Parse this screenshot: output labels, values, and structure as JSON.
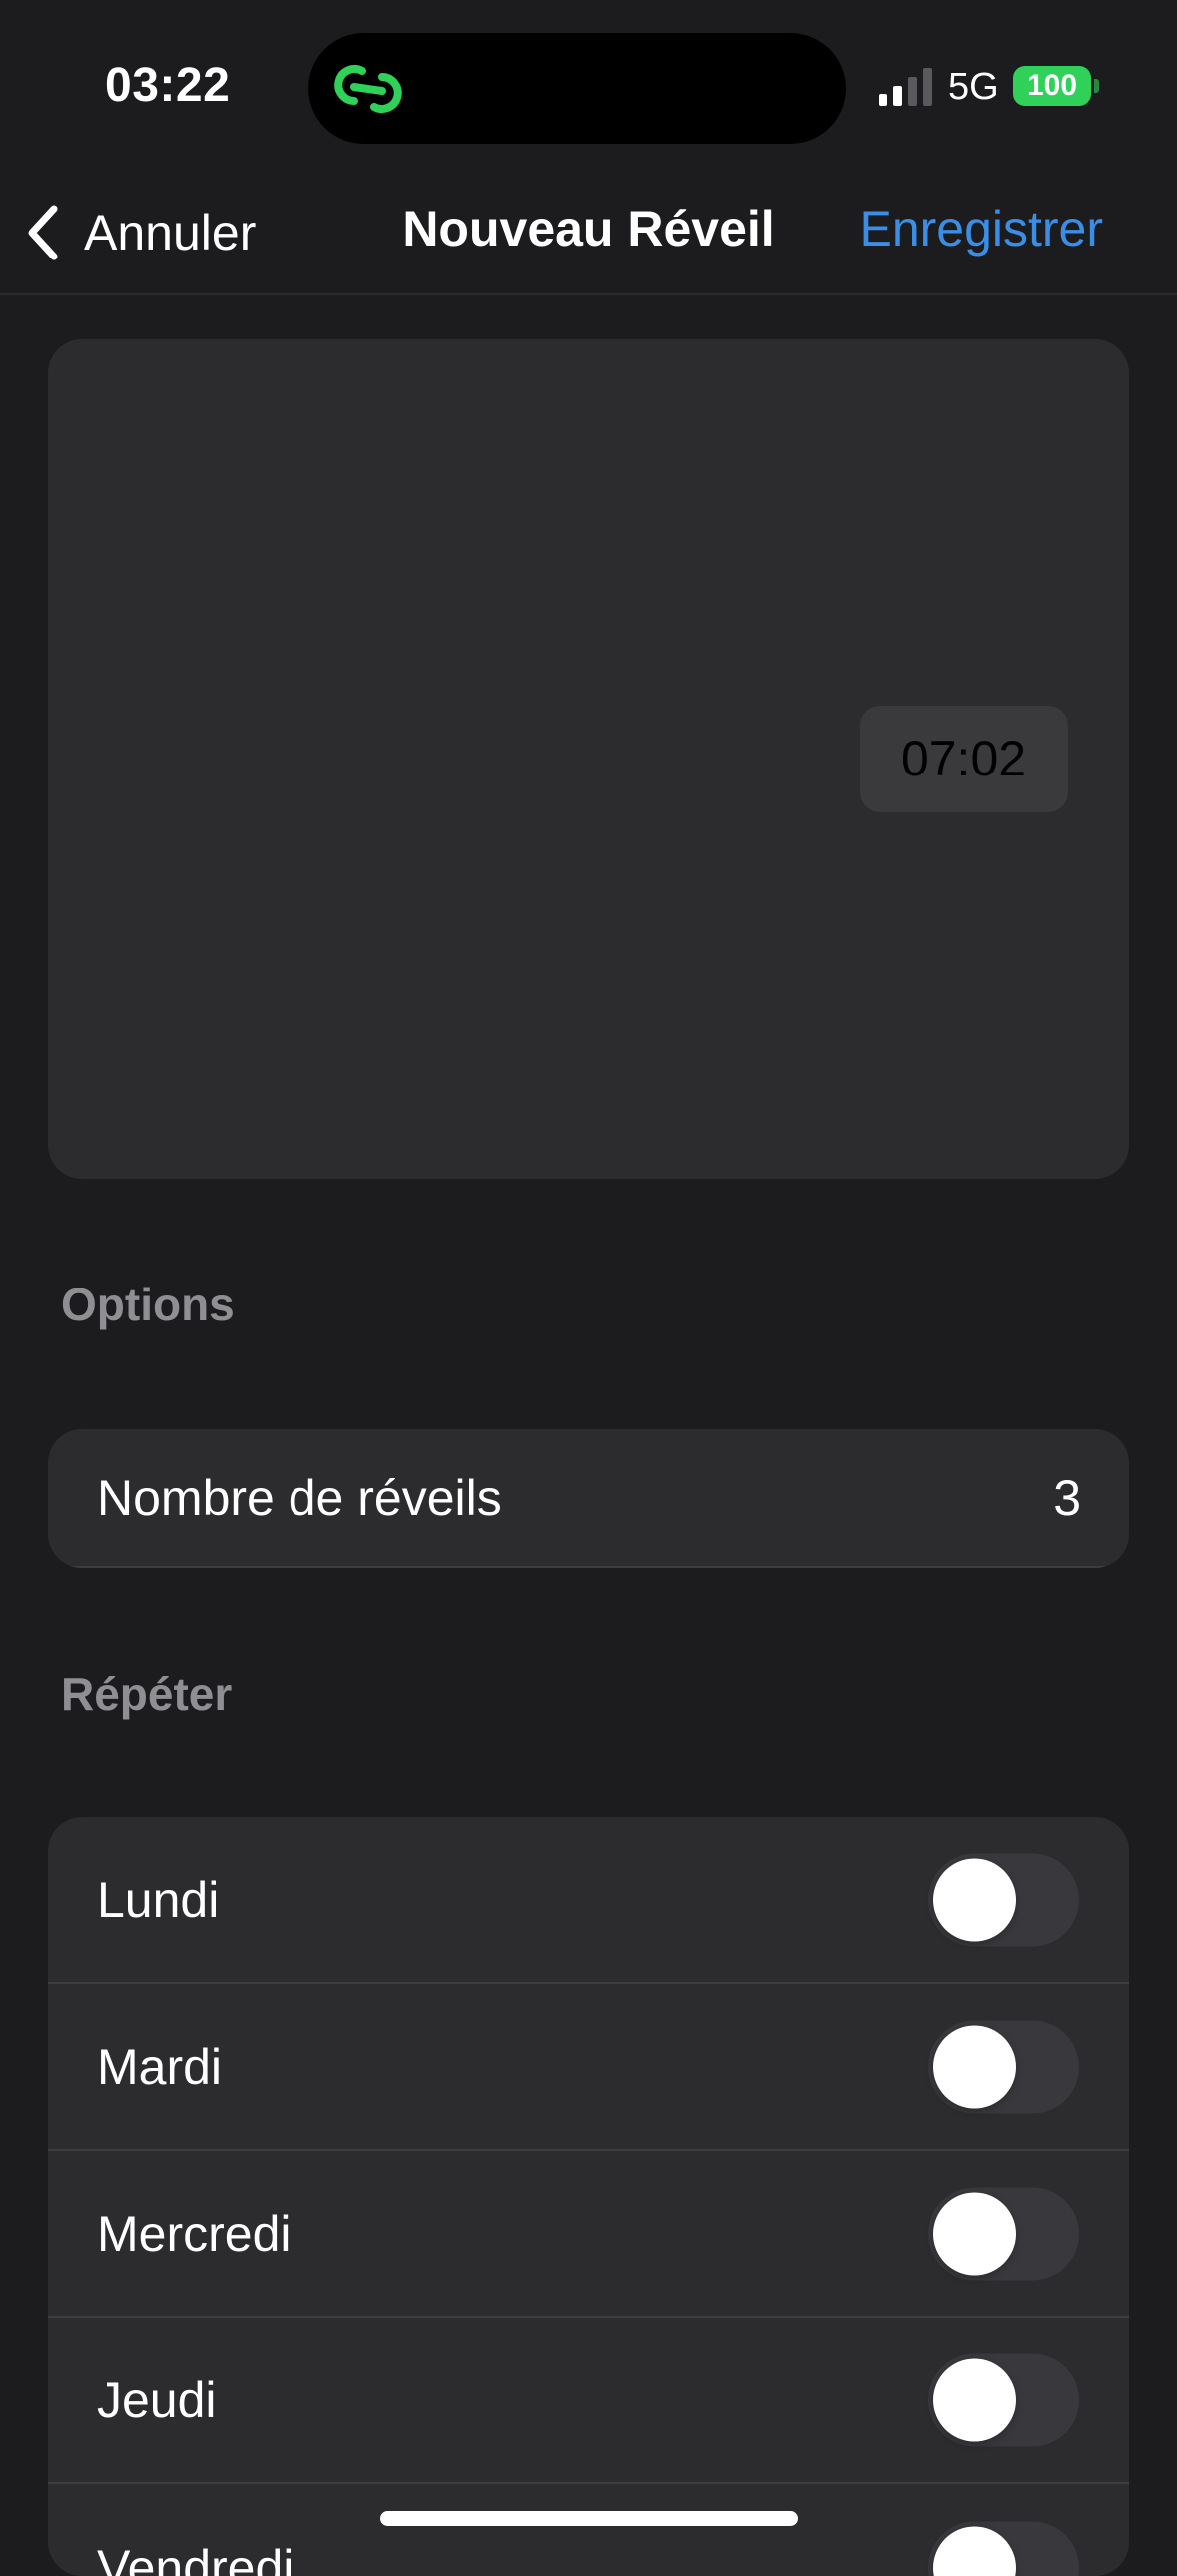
{
  "status_bar": {
    "time": "03:22",
    "network": "5G",
    "battery": "100",
    "island_icon": "link-chain-icon",
    "accent_green": "#30d158"
  },
  "nav": {
    "back_label": "Annuler",
    "title": "Nouveau Réveil",
    "save_label": "Enregistrer",
    "accent_blue": "#3a8ee6"
  },
  "picker": {
    "time": "07:02"
  },
  "options": {
    "header": "Options",
    "rows": [
      {
        "label": "Nombre de réveils",
        "value": "3"
      }
    ]
  },
  "repeat": {
    "header": "Répéter",
    "days": [
      {
        "label": "Lundi",
        "on": false
      },
      {
        "label": "Mardi",
        "on": false
      },
      {
        "label": "Mercredi",
        "on": false
      },
      {
        "label": "Jeudi",
        "on": false
      },
      {
        "label": "Vendredi",
        "on": false
      }
    ]
  }
}
